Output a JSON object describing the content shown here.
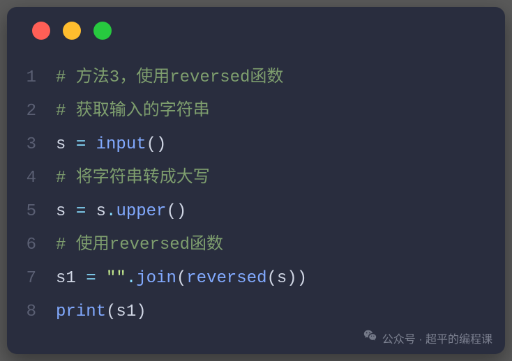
{
  "traffic_lights": [
    "red",
    "yellow",
    "green"
  ],
  "code": {
    "lines": [
      {
        "n": "1",
        "tokens": [
          {
            "t": "# 方法3，使用reversed函数",
            "c": "comment"
          }
        ]
      },
      {
        "n": "2",
        "tokens": [
          {
            "t": "# 获取输入的字符串",
            "c": "comment"
          }
        ]
      },
      {
        "n": "3",
        "tokens": [
          {
            "t": "s ",
            "c": "default"
          },
          {
            "t": "=",
            "c": "operator"
          },
          {
            "t": " ",
            "c": "default"
          },
          {
            "t": "input",
            "c": "func"
          },
          {
            "t": "()",
            "c": "paren"
          }
        ]
      },
      {
        "n": "4",
        "tokens": [
          {
            "t": "# 将字符串转成大写",
            "c": "comment"
          }
        ]
      },
      {
        "n": "5",
        "tokens": [
          {
            "t": "s ",
            "c": "default"
          },
          {
            "t": "=",
            "c": "operator"
          },
          {
            "t": " s",
            "c": "default"
          },
          {
            "t": ".",
            "c": "operator"
          },
          {
            "t": "upper",
            "c": "func"
          },
          {
            "t": "()",
            "c": "paren"
          }
        ]
      },
      {
        "n": "6",
        "tokens": [
          {
            "t": "# 使用reversed函数",
            "c": "comment"
          }
        ]
      },
      {
        "n": "7",
        "tokens": [
          {
            "t": "s1 ",
            "c": "default"
          },
          {
            "t": "=",
            "c": "operator"
          },
          {
            "t": " ",
            "c": "default"
          },
          {
            "t": "\"\"",
            "c": "string"
          },
          {
            "t": ".",
            "c": "operator"
          },
          {
            "t": "join",
            "c": "func"
          },
          {
            "t": "(",
            "c": "paren"
          },
          {
            "t": "reversed",
            "c": "func"
          },
          {
            "t": "(",
            "c": "paren"
          },
          {
            "t": "s",
            "c": "default"
          },
          {
            "t": "))",
            "c": "paren"
          }
        ]
      },
      {
        "n": "8",
        "tokens": [
          {
            "t": "print",
            "c": "func"
          },
          {
            "t": "(",
            "c": "paren"
          },
          {
            "t": "s1",
            "c": "default"
          },
          {
            "t": ")",
            "c": "paren"
          }
        ]
      }
    ]
  },
  "watermark": {
    "label": "公众号 · 超平的编程课"
  }
}
